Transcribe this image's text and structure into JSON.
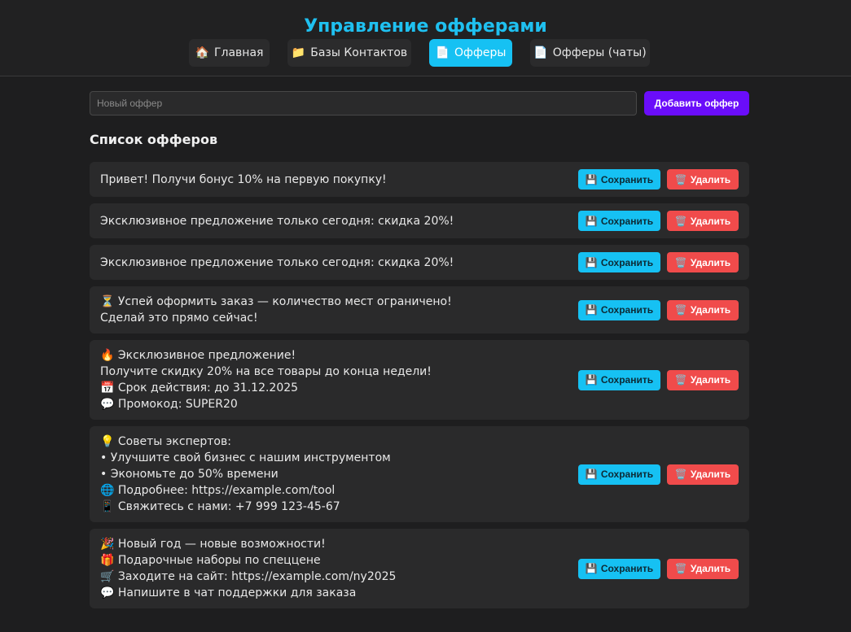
{
  "header": {
    "title": "Управление офферами",
    "nav": [
      {
        "icon": "🏠",
        "icon_name": "home-icon",
        "label": "Главная",
        "active": false
      },
      {
        "icon": "📁",
        "icon_name": "folder-icon",
        "label": "Базы Контактов",
        "active": false
      },
      {
        "icon": "📄",
        "icon_name": "document-icon",
        "label": "Офферы",
        "active": true
      },
      {
        "icon": "📄",
        "icon_name": "document-icon",
        "label": "Офферы (чаты)",
        "active": false
      }
    ]
  },
  "add_offer": {
    "placeholder": "Новый оффер",
    "value": "",
    "button_label": "Добавить оффер"
  },
  "list": {
    "title": "Список офферов",
    "save_label": "Сохранить",
    "save_icon": "💾",
    "delete_label": "Удалить",
    "delete_icon": "🗑️",
    "offers": [
      {
        "text": "Привет! Получи бонус 10% на первую покупку!"
      },
      {
        "text": "Эксклюзивное предложение только сегодня: скидка 20%!"
      },
      {
        "text": "Эксклюзивное предложение только сегодня: скидка 20%!"
      },
      {
        "text": "⏳ Успей оформить заказ — количество мест ограничено!\nСделай это прямо сейчас!"
      },
      {
        "text": "🔥 Эксклюзивное предложение!\nПолучите скидку 20% на все товары до конца недели!\n📅 Срок действия: до 31.12.2025\n💬 Промокод: SUPER20"
      },
      {
        "text": "💡 Советы экспертов:\n• Улучшите свой бизнес с нашим инструментом\n• Экономьте до 50% времени\n🌐 Подробнее: https://example.com/tool\n📱 Свяжитесь с нами: +7 999 123-45-67"
      },
      {
        "text": "🎉 Новый год — новые возможности!\n🎁 Подарочные наборы по спеццене\n🛒 Заходите на сайт: https://example.com/ny2025\n💬 Напишите в чат поддержки для заказа"
      }
    ]
  },
  "colors": {
    "accent": "#16c1f3",
    "title": "#1fc0f0",
    "add_button": "#6a0dfa",
    "delete_button": "#f04b4b",
    "background": "#1e1e1f",
    "card": "#2a2a2b"
  }
}
